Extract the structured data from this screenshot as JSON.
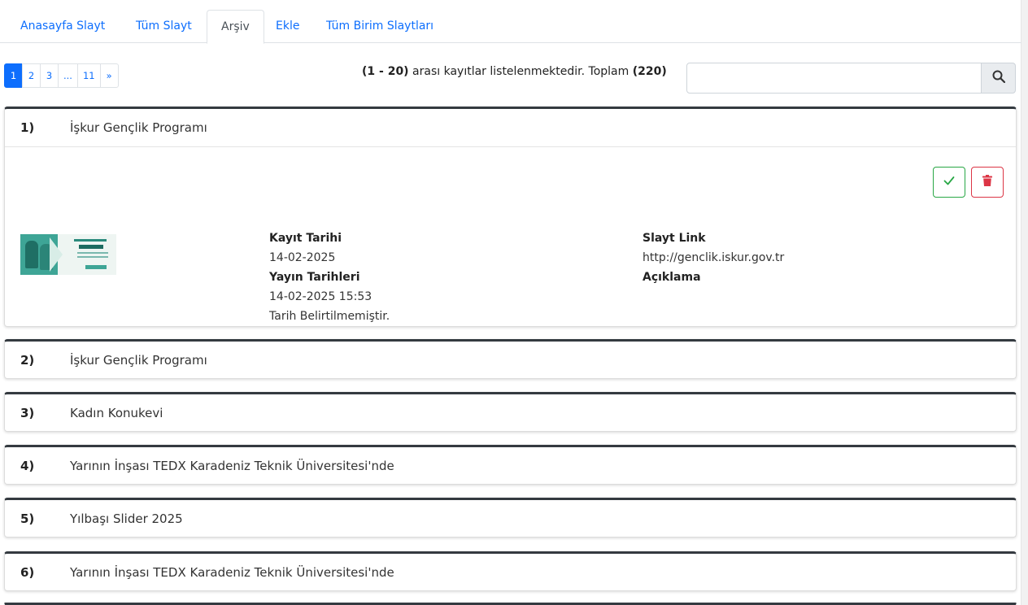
{
  "tabs": [
    {
      "label": "Anasayfa Slayt",
      "active": false
    },
    {
      "label": "Tüm Slayt",
      "active": false
    },
    {
      "label": "Arşiv",
      "active": true
    },
    {
      "label": "Ekle",
      "active": false
    },
    {
      "label": "Tüm Birim Slaytları",
      "active": false
    }
  ],
  "pagination": {
    "pages": [
      "1",
      "2",
      "3",
      "...",
      "11",
      "»"
    ],
    "current": "1"
  },
  "summary": {
    "range": "(1 - 20)",
    "middle": "arası kayıtlar listelenmektedir. Toplam",
    "total": "(220)"
  },
  "search": {
    "value": "",
    "placeholder": "",
    "icon": "search-icon"
  },
  "records": [
    {
      "num": "1)",
      "title": "İşkur Gençlik Programı",
      "expanded": true,
      "kayit_label": "Kayıt Tarihi",
      "kayit_value": "14-02-2025",
      "yayin_label": "Yayın Tarihleri",
      "yayin_value": "14-02-2025 15:53",
      "yayin_note": "Tarih Belirtilmemiştir.",
      "link_label": "Slayt Link",
      "link_value": "http://genclik.iskur.gov.tr",
      "aciklama_label": "Açıklama",
      "approve_icon": "check-icon",
      "delete_icon": "trash-icon",
      "colors": {
        "approve": "#28a745",
        "delete": "#dc3545"
      }
    },
    {
      "num": "2)",
      "title": "İşkur Gençlik Programı",
      "expanded": false
    },
    {
      "num": "3)",
      "title": "Kadın Konukevi",
      "expanded": false
    },
    {
      "num": "4)",
      "title": "Yarının İnşası TEDX Karadeniz Teknik Üniversitesi'nde",
      "expanded": false
    },
    {
      "num": "5)",
      "title": "Yılbaşı Slider 2025",
      "expanded": false
    },
    {
      "num": "6)",
      "title": "Yarının İnşası TEDX Karadeniz Teknik Üniversitesi'nde",
      "expanded": false
    }
  ],
  "colors": {
    "primary": "#0d6efd",
    "card_top": "#343a40"
  }
}
